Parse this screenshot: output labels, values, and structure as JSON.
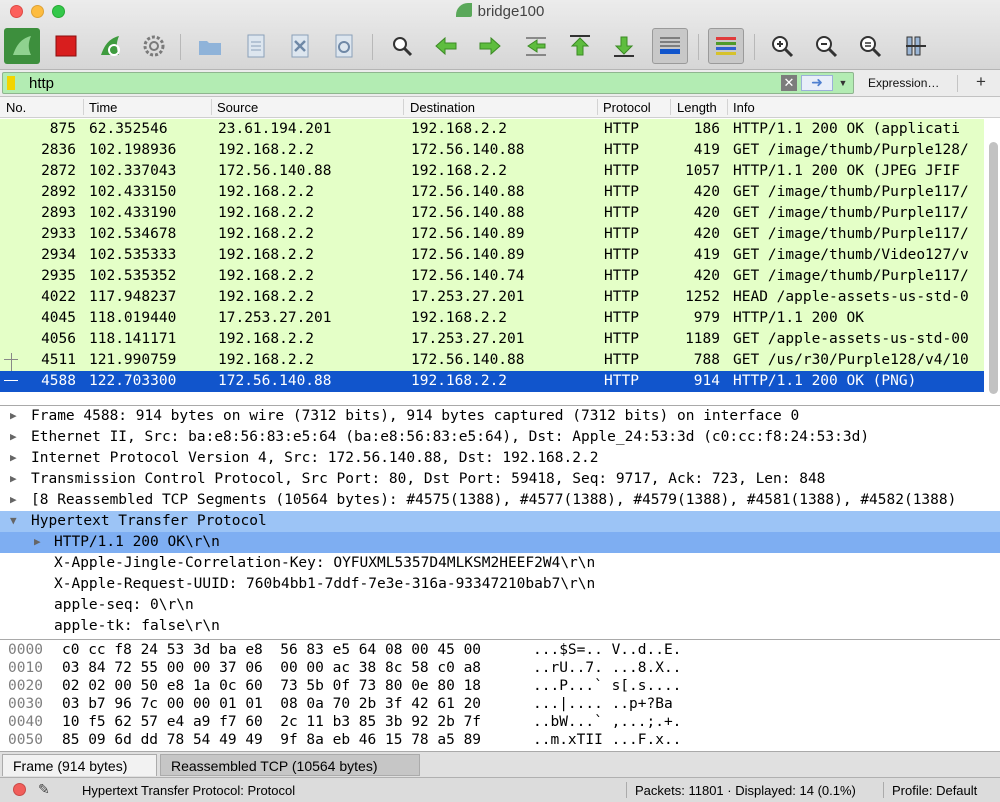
{
  "window": {
    "title": "bridge100"
  },
  "toolbar": {
    "icons": [
      "shark-fin-start-icon",
      "stop-icon",
      "restart-capture-icon",
      "capture-options-gear-icon",
      "open-folder-icon",
      "save-file-icon",
      "close-file-icon",
      "reload-file-icon",
      "find-packet-icon",
      "go-back-icon",
      "go-forward-icon",
      "go-to-packet-icon",
      "first-packet-icon",
      "last-packet-icon",
      "autoscroll-icon",
      "colorize-icon",
      "zoom-in-icon",
      "zoom-out-icon",
      "zoom-normal-icon",
      "resize-columns-icon"
    ]
  },
  "filter": {
    "value": "http",
    "expression_label": "Expression…",
    "add_label": "+"
  },
  "packet_list": {
    "columns": [
      "No.",
      "Time",
      "Source",
      "Destination",
      "Protocol",
      "Length",
      "Info"
    ],
    "rows": [
      {
        "no": "875",
        "time": "62.352546",
        "src": "23.61.194.201",
        "dst": "192.168.2.2",
        "proto": "HTTP",
        "len": "186",
        "info": "HTTP/1.1 200 OK  (applicati"
      },
      {
        "no": "2836",
        "time": "102.198936",
        "src": "192.168.2.2",
        "dst": "172.56.140.88",
        "proto": "HTTP",
        "len": "419",
        "info": "GET /image/thumb/Purple128/"
      },
      {
        "no": "2872",
        "time": "102.337043",
        "src": "172.56.140.88",
        "dst": "192.168.2.2",
        "proto": "HTTP",
        "len": "1057",
        "info": "HTTP/1.1 200 OK  (JPEG JFIF"
      },
      {
        "no": "2892",
        "time": "102.433150",
        "src": "192.168.2.2",
        "dst": "172.56.140.88",
        "proto": "HTTP",
        "len": "420",
        "info": "GET /image/thumb/Purple117/"
      },
      {
        "no": "2893",
        "time": "102.433190",
        "src": "192.168.2.2",
        "dst": "172.56.140.88",
        "proto": "HTTP",
        "len": "420",
        "info": "GET /image/thumb/Purple117/"
      },
      {
        "no": "2933",
        "time": "102.534678",
        "src": "192.168.2.2",
        "dst": "172.56.140.89",
        "proto": "HTTP",
        "len": "420",
        "info": "GET /image/thumb/Purple117/"
      },
      {
        "no": "2934",
        "time": "102.535333",
        "src": "192.168.2.2",
        "dst": "172.56.140.89",
        "proto": "HTTP",
        "len": "419",
        "info": "GET /image/thumb/Video127/v"
      },
      {
        "no": "2935",
        "time": "102.535352",
        "src": "192.168.2.2",
        "dst": "172.56.140.74",
        "proto": "HTTP",
        "len": "420",
        "info": "GET /image/thumb/Purple117/"
      },
      {
        "no": "4022",
        "time": "117.948237",
        "src": "192.168.2.2",
        "dst": "17.253.27.201",
        "proto": "HTTP",
        "len": "1252",
        "info": "HEAD /apple-assets-us-std-0"
      },
      {
        "no": "4045",
        "time": "118.019440",
        "src": "17.253.27.201",
        "dst": "192.168.2.2",
        "proto": "HTTP",
        "len": "979",
        "info": "HTTP/1.1 200 OK"
      },
      {
        "no": "4056",
        "time": "118.141171",
        "src": "192.168.2.2",
        "dst": "17.253.27.201",
        "proto": "HTTP",
        "len": "1189",
        "info": "GET /apple-assets-us-std-00"
      },
      {
        "no": "4511",
        "time": "121.990759",
        "src": "192.168.2.2",
        "dst": "172.56.140.88",
        "proto": "HTTP",
        "len": "788",
        "info": "GET /us/r30/Purple128/v4/10"
      },
      {
        "no": "4588",
        "time": "122.703300",
        "src": "172.56.140.88",
        "dst": "192.168.2.2",
        "proto": "HTTP",
        "len": "914",
        "info": "HTTP/1.1 200 OK  (PNG)"
      }
    ]
  },
  "detail": {
    "rows": [
      {
        "text": "Frame 4588: 914 bytes on wire (7312 bits), 914 bytes captured (7312 bits) on interface 0",
        "level": 0,
        "arrow": "▶"
      },
      {
        "text": "Ethernet II, Src: ba:e8:56:83:e5:64 (ba:e8:56:83:e5:64), Dst: Apple_24:53:3d (c0:cc:f8:24:53:3d)",
        "level": 0,
        "arrow": "▶"
      },
      {
        "text": "Internet Protocol Version 4, Src: 172.56.140.88, Dst: 192.168.2.2",
        "level": 0,
        "arrow": "▶"
      },
      {
        "text": "Transmission Control Protocol, Src Port: 80, Dst Port: 59418, Seq: 9717, Ack: 723, Len: 848",
        "level": 0,
        "arrow": "▶"
      },
      {
        "text": "[8 Reassembled TCP Segments (10564 bytes): #4575(1388), #4577(1388), #4579(1388), #4581(1388), #4582(1388)",
        "level": 0,
        "arrow": "▶"
      },
      {
        "text": "Hypertext Transfer Protocol",
        "level": 0,
        "arrow": "▼"
      },
      {
        "text": "HTTP/1.1 200 OK\\r\\n",
        "level": 1,
        "arrow": "▶"
      },
      {
        "text": "X-Apple-Jingle-Correlation-Key: OYFUXML5357D4MLKSM2HEEF2W4\\r\\n",
        "level": 1,
        "arrow": ""
      },
      {
        "text": "X-Apple-Request-UUID: 760b4bb1-7ddf-7e3e-316a-93347210bab7\\r\\n",
        "level": 1,
        "arrow": ""
      },
      {
        "text": "apple-seq: 0\\r\\n",
        "level": 1,
        "arrow": ""
      },
      {
        "text": "apple-tk: false\\r\\n",
        "level": 1,
        "arrow": ""
      }
    ]
  },
  "hex": {
    "rows": [
      {
        "off": "0000",
        "bytes": "c0 cc f8 24 53 3d ba e8  56 83 e5 64 08 00 45 00",
        "ascii": "...$S=.. V..d..E."
      },
      {
        "off": "0010",
        "bytes": "03 84 72 55 00 00 37 06  00 00 ac 38 8c 58 c0 a8",
        "ascii": "..rU..7. ...8.X.."
      },
      {
        "off": "0020",
        "bytes": "02 02 00 50 e8 1a 0c 60  73 5b 0f 73 80 0e 80 18",
        "ascii": "...P...` s[.s...."
      },
      {
        "off": "0030",
        "bytes": "03 b7 96 7c 00 00 01 01  08 0a 70 2b 3f 42 61 20",
        "ascii": "...|.... ..p+?Ba"
      },
      {
        "off": "0040",
        "bytes": "10 f5 62 57 e4 a9 f7 60  2c 11 b3 85 3b 92 2b 7f",
        "ascii": "..bW...` ,...;.+."
      },
      {
        "off": "0050",
        "bytes": "85 09 6d dd 78 54 49 49  9f 8a eb 46 15 78 a5 89",
        "ascii": "..m.xTII ...F.x.."
      }
    ]
  },
  "tabs": [
    "Frame (914 bytes)",
    "Reassembled TCP (10564 bytes)"
  ],
  "status": {
    "field": "Hypertext Transfer Protocol: Protocol",
    "packets": "Packets: 11801 · Displayed: 14 (0.1%)",
    "profile": "Profile: Default"
  },
  "colors": {
    "http_row": "#e4ffc7",
    "selected_row": "#1155cc",
    "filter_valid": "#b3ecb3",
    "tree_selected": "#7eaef2"
  }
}
